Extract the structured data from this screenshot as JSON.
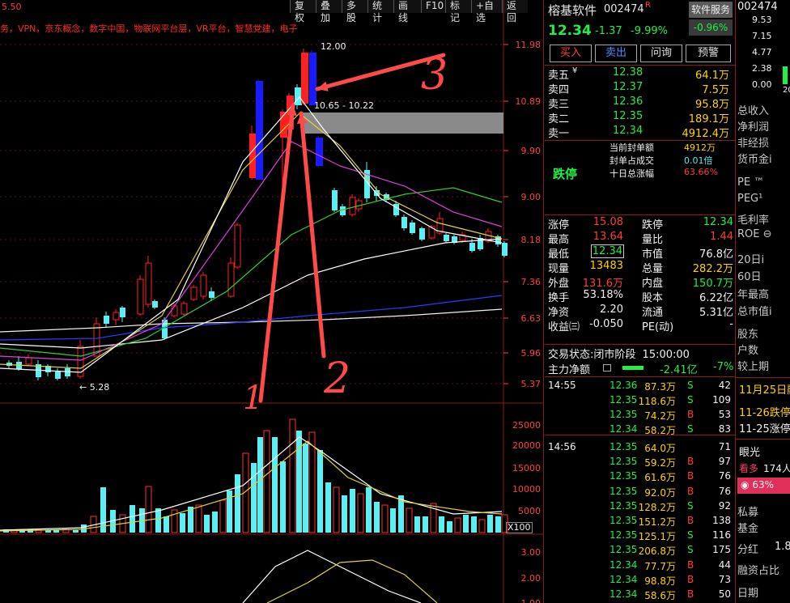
{
  "toolbar": {
    "items": [
      "复权",
      "叠加",
      "多股",
      "统计",
      "画线",
      "F10",
      "标记",
      "+自选",
      "返回"
    ]
  },
  "concept_line": "务，VPN，京东概念，数字中国，物联网平台层，VR平台，智慧党建，电子",
  "chart": {
    "top_left_label": "5.50",
    "price_axis": [
      "11.98",
      "10.89",
      "9.90",
      "9.00",
      "8.18",
      "7.36",
      "6.63",
      "5.96",
      "5.37"
    ],
    "high_marker": "12.00",
    "low_marker": "5.28",
    "range_label": "10.65 - 10.22",
    "volume_axis": [
      "25000",
      "20000",
      "15000",
      "10000",
      "5000"
    ],
    "volume_unit": "X100",
    "indicator_axis": [
      "3.00",
      "2.00",
      "1.00"
    ],
    "annotations": [
      "3",
      "2",
      "1"
    ]
  },
  "stock": {
    "name": "榕基软件",
    "code": "002474",
    "flag": "R",
    "sector_tag": "软件服务",
    "sector_change": "-0.96%",
    "price": "12.34",
    "change": "-1.37",
    "change_pct": "-9.99%",
    "buttons": [
      "买入",
      "卖出",
      "问询",
      "预警"
    ]
  },
  "order_book": {
    "asks": [
      {
        "label": "卖五",
        "mark": "¥",
        "price": "12.38",
        "vol": "64.1万"
      },
      {
        "label": "卖四",
        "mark": "",
        "price": "12.37",
        "vol": "7.5万"
      },
      {
        "label": "卖三",
        "mark": "",
        "price": "12.36",
        "vol": "95.8万"
      },
      {
        "label": "卖二",
        "mark": "",
        "price": "12.35",
        "vol": "189.1万"
      },
      {
        "label": "卖一",
        "mark": "",
        "price": "12.34",
        "vol": "4912.4万"
      }
    ],
    "limit_status": "跌停",
    "seal_rows": [
      {
        "label": "当前封单额",
        "value": "4912万"
      },
      {
        "label": "封单占成交",
        "value": "0.01倍"
      },
      {
        "label": "十日总涨幅",
        "value": "63.66%"
      }
    ]
  },
  "stats": {
    "rows": [
      [
        {
          "k": "涨停",
          "v": "15.08"
        },
        {
          "k": "跌停",
          "v": "12.34"
        }
      ],
      [
        {
          "k": "最高",
          "v": "13.64"
        },
        {
          "k": "量比",
          "v": "1.44"
        }
      ],
      [
        {
          "k": "最低",
          "v": "12.34"
        },
        {
          "k": "市值",
          "v": "76.8亿"
        }
      ],
      [
        {
          "k": "现量",
          "v": "13483"
        },
        {
          "k": "总量",
          "v": "282.2万"
        }
      ],
      [
        {
          "k": "外盘",
          "v": "131.6万"
        },
        {
          "k": "内盘",
          "v": "150.7万"
        }
      ],
      [
        {
          "k": "换手",
          "v": "53.18%"
        },
        {
          "k": "股本",
          "v": "6.22亿"
        }
      ],
      [
        {
          "k": "净资",
          "v": "2.20"
        },
        {
          "k": "流通",
          "v": "5.31亿"
        }
      ],
      [
        {
          "k": "收益㈢",
          "v": "-0.050"
        },
        {
          "k": "PE(动)",
          "v": "-"
        }
      ]
    ],
    "trade_state_label": "交易状态:",
    "trade_state": "闭市阶段",
    "trade_time": "15:00:00",
    "main_flow_label": "主力净额",
    "main_flow_value": "-2.41亿",
    "main_flow_pct": "-7%"
  },
  "ticks": [
    {
      "time": "14:55",
      "price": "12.36",
      "vol": "87.3万",
      "side": "S",
      "n": "42"
    },
    {
      "time": "",
      "price": "12.35",
      "vol": "118.6万",
      "side": "S",
      "n": "109"
    },
    {
      "time": "",
      "price": "12.35",
      "vol": "74.2万",
      "side": "B",
      "n": "53"
    },
    {
      "time": "",
      "price": "12.34",
      "vol": "58.2万",
      "side": "S",
      "n": "83"
    },
    {
      "time": "14:56",
      "price": "12.35",
      "vol": "64.0万",
      "side": "",
      "n": "71"
    },
    {
      "time": "",
      "price": "12.35",
      "vol": "59.2万",
      "side": "B",
      "n": "97"
    },
    {
      "time": "",
      "price": "12.35",
      "vol": "61.6万",
      "side": "B",
      "n": "76"
    },
    {
      "time": "",
      "price": "12.35",
      "vol": "92.0万",
      "side": "B",
      "n": "76"
    },
    {
      "time": "",
      "price": "12.35",
      "vol": "128.2万",
      "side": "S",
      "n": "92"
    },
    {
      "time": "",
      "price": "12.35",
      "vol": "151.2万",
      "side": "B",
      "n": "138"
    },
    {
      "time": "",
      "price": "12.35",
      "vol": "125.1万",
      "side": "S",
      "n": "116"
    },
    {
      "time": "",
      "price": "12.35",
      "vol": "206.8万",
      "side": "S",
      "n": "175"
    },
    {
      "time": "",
      "price": "12.34",
      "vol": "77.7万",
      "side": "B",
      "n": "44"
    },
    {
      "time": "",
      "price": "12.34",
      "vol": "98.8万",
      "side": "B",
      "n": "73"
    },
    {
      "time": "",
      "price": "12.34",
      "vol": "58.6万",
      "side": "B",
      "n": "50"
    }
  ],
  "sidebar": {
    "code": "002474",
    "mini_axis": [
      "9.53",
      "7.15",
      "4.77",
      "2.38",
      "0.00"
    ],
    "mini_x": "20",
    "items": [
      "总收入",
      "净利润",
      "非经损",
      "货币金i",
      "PE ™",
      "PEG¹",
      "毛利率",
      "ROE ⊖",
      "20日i",
      "60日",
      "年最高",
      "总市值i",
      "股东",
      "户数",
      "较上期"
    ],
    "news": [
      "11月25日融",
      "11-26跌停",
      "11-25涨停"
    ],
    "eyes": "眼光",
    "bullish": "看多",
    "people": "174人",
    "pct": "63%",
    "bottom": [
      "私募",
      "基金",
      "分红",
      "融资占比",
      "日期"
    ],
    "dividend": "1.8"
  }
}
